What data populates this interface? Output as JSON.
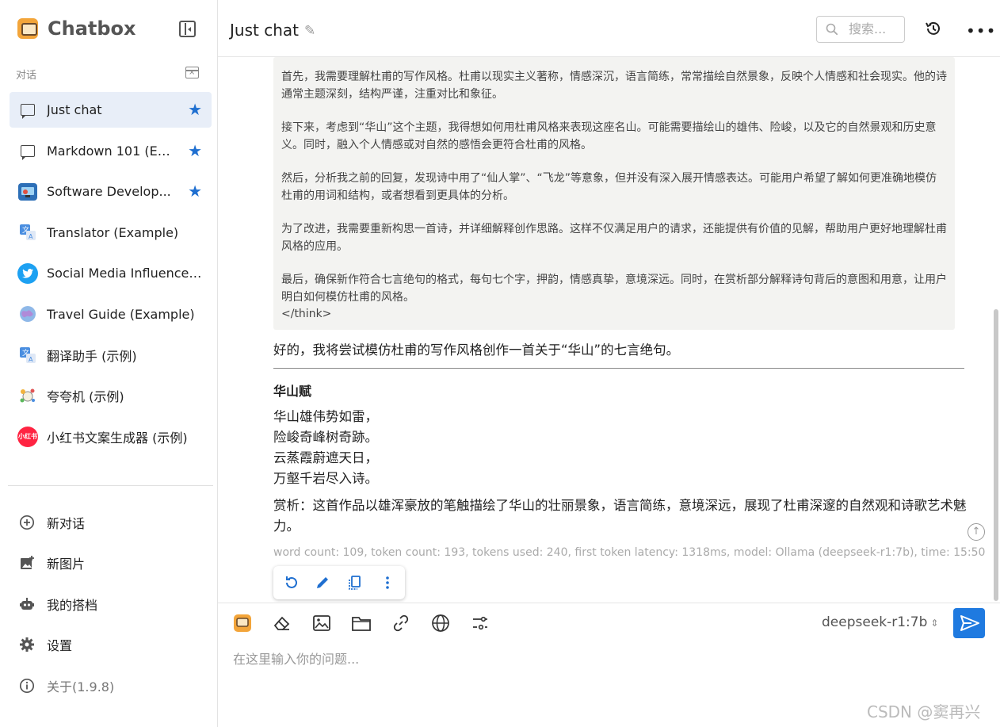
{
  "sidebar": {
    "brand": "Chatbox",
    "section_label": "对话",
    "sessions": [
      {
        "label": "Just chat",
        "starred": true
      },
      {
        "label": "Markdown 101 (Ex...",
        "starred": true
      },
      {
        "label": "Software Develop...",
        "starred": true
      },
      {
        "label": "Translator (Example)",
        "starred": false
      },
      {
        "label": "Social Media Influencer ...",
        "starred": false
      },
      {
        "label": "Travel Guide (Example)",
        "starred": false
      },
      {
        "label": "翻译助手 (示例)",
        "starred": false
      },
      {
        "label": "夸夸机 (示例)",
        "starred": false
      },
      {
        "label": "小红书文案生成器 (示例)",
        "starred": false
      }
    ],
    "avatar_text_xhs": "小红书",
    "nav": {
      "new_chat": "新对话",
      "new_image": "新图片",
      "my_copilots": "我的搭档",
      "settings": "设置",
      "about": "关于(1.9.8)"
    }
  },
  "header": {
    "title": "Just chat",
    "search_placeholder": "搜索..."
  },
  "message": {
    "think": [
      "首先，我需要理解杜甫的写作风格。杜甫以现实主义著称，情感深沉，语言简练，常常描绘自然景象，反映个人情感和社会现实。他的诗通常主题深刻，结构严谨，注重对比和象征。",
      "接下来，考虑到“华山”这个主题，我得想如何用杜甫风格来表现这座名山。可能需要描绘山的雄伟、险峻，以及它的自然景观和历史意义。同时，融入个人情感或对自然的感悟会更符合杜甫的风格。",
      "然后，分析我之前的回复，发现诗中用了“仙人掌”、“飞龙”等意象，但并没有深入展开情感表达。可能用户希望了解如何更准确地模仿杜甫的用词和结构，或者想看到更具体的分析。",
      "为了改进，我需要重新构思一首诗，并详细解释创作思路。这样不仅满足用户的请求，还能提供有价值的见解，帮助用户更好地理解杜甫风格的应用。",
      "最后，确保新作符合七言绝句的格式，每句七个字，押韵，情感真挚，意境深远。同时，在赏析部分解释诗句背后的意图和用意，让用户明白如何模仿杜甫的风格。"
    ],
    "think_close": "</think>",
    "intro": "好的，我将尝试模仿杜甫的写作风格创作一首关于“华山”的七言绝句。",
    "poem_title": "华山赋",
    "poem_lines": [
      "华山雄伟势如雷，",
      "险峻奇峰树奇跡。",
      "云蒸霞蔚遮天日，",
      "万壑千岩尽入诗。"
    ],
    "analysis": "赏析：这首作品以雄浑豪放的笔触描绘了华山的壮丽景象，语言简练，意境深远，展现了杜甫深邃的自然观和诗歌艺术魅力。",
    "meta": "word count: 109, token count: 193, tokens used: 240, first token latency: 1318ms, model: Ollama (deepseek-r1:7b), time: 15:50"
  },
  "composer": {
    "model": "deepseek-r1:7b",
    "placeholder": "在这里输入你的问题..."
  },
  "watermark": "CSDN @窦再兴",
  "colors": {
    "accent": "#1f7ae0",
    "star": "#1f6fd0",
    "active_bg": "#e8eef8",
    "think_bg": "#f3f3f1"
  }
}
